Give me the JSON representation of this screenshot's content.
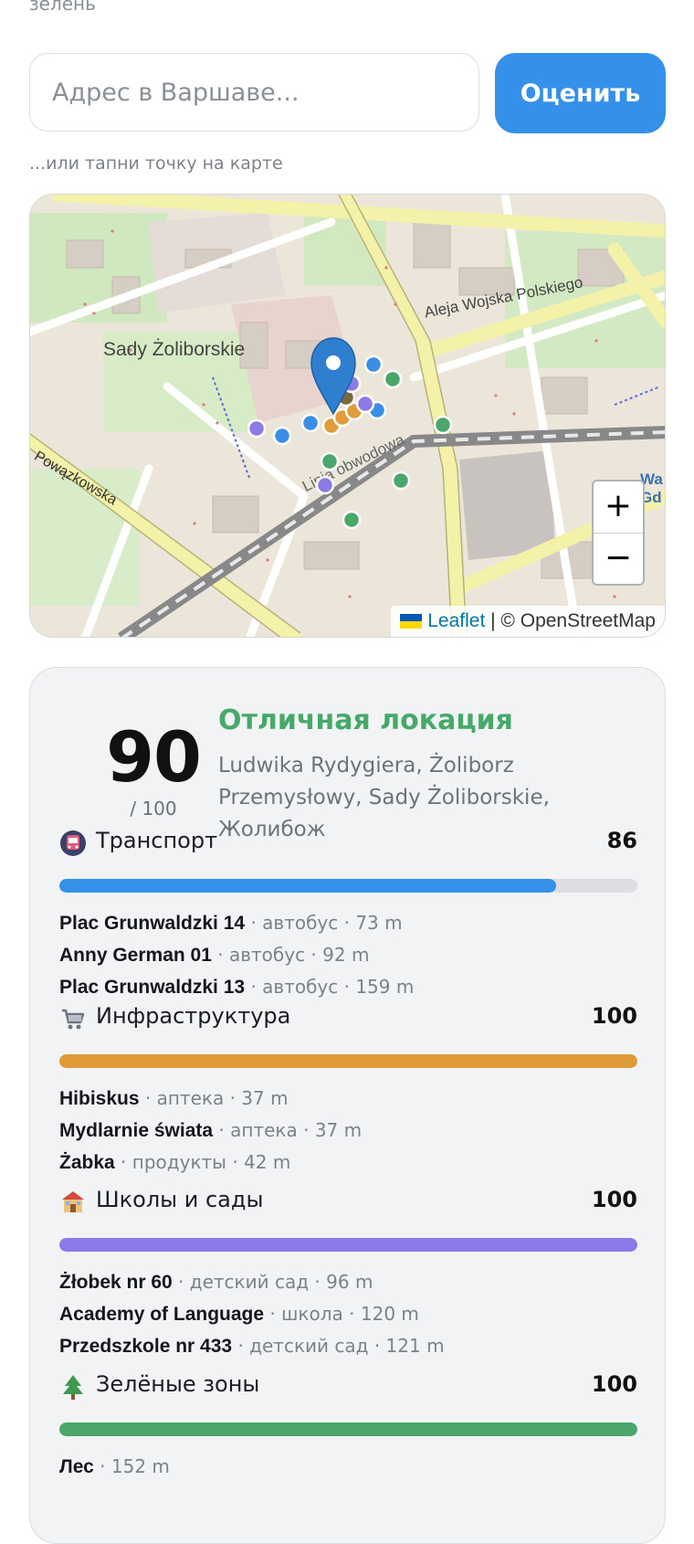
{
  "header": {
    "top_text": "зелень"
  },
  "search": {
    "placeholder": "Адрес в Варшаве...",
    "value": "",
    "button_label": "Оценить"
  },
  "hint": "...или тапни точку на карте",
  "map": {
    "labels": {
      "district": "Sady Żoliborskie",
      "avenue": "Aleja Wojska Polskiego",
      "street_powazkowska": "Powązkowska",
      "railway": "Linia obwodowa",
      "edge_a": "Wa",
      "edge_b": "Gd"
    },
    "zoom_in": "+",
    "zoom_out": "−",
    "attribution_link": "Leaflet",
    "attribution_text": "| © OpenStreetMap",
    "marker_colors": {
      "transport": "#3b8ee6",
      "infra": "#e19d3a",
      "schools": "#8e7ae6",
      "green": "#4aa66a"
    }
  },
  "result": {
    "score": "90",
    "score_max": "/ 100",
    "verdict": "Отличная локация",
    "verdict_color": "#46a96a",
    "address": "Ludwika Rydygiera, Żoliborz Przemysłowy, Sady Żoliborskie, Жолибож",
    "categories": [
      {
        "icon": "tram-icon",
        "title": "Транспорт",
        "score": "86",
        "fill_percent": 86,
        "color": "#3590ea",
        "items": [
          {
            "name": "Plac Grunwaldzki 14",
            "meta": " · автобус · 73 m"
          },
          {
            "name": "Anny German 01",
            "meta": " · автобус · 92 m"
          },
          {
            "name": "Plac Grunwaldzki 13",
            "meta": " · автобус · 159 m"
          }
        ]
      },
      {
        "icon": "shopping-cart-icon",
        "title": "Инфраструктура",
        "score": "100",
        "fill_percent": 100,
        "color": "#df9b38",
        "items": [
          {
            "name": "Hibiskus",
            "meta": " · аптека · 37 m"
          },
          {
            "name": "Mydlarnie świata",
            "meta": " · аптека · 37 m"
          },
          {
            "name": "Żabka",
            "meta": " · продукты · 42 m"
          }
        ]
      },
      {
        "icon": "school-icon",
        "title": "Школы и сады",
        "score": "100",
        "fill_percent": 100,
        "color": "#8d79ec",
        "items": [
          {
            "name": "Żłobek nr 60",
            "meta": " · детский сад · 96 m"
          },
          {
            "name": "Academy of Language",
            "meta": " · школа · 120 m"
          },
          {
            "name": "Przedszkole nr 433",
            "meta": " · детский сад · 121 m"
          }
        ]
      },
      {
        "icon": "tree-icon",
        "title": "Зелёные зоны",
        "score": "100",
        "fill_percent": 100,
        "color": "#4aa66a",
        "items": [
          {
            "name": "Лес",
            "meta": " · 152 m"
          }
        ]
      }
    ]
  }
}
